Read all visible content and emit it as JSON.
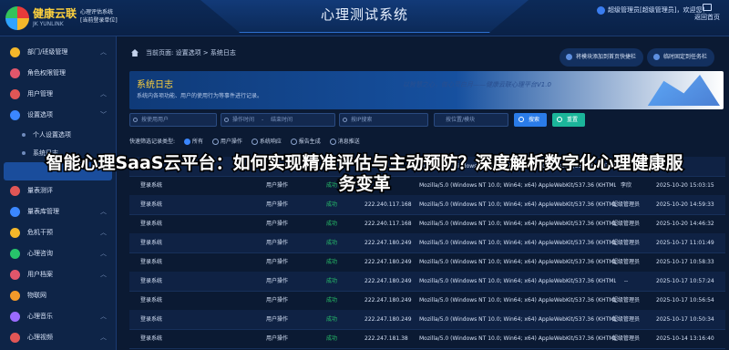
{
  "header": {
    "logo_name": "健康云联",
    "logo_en": "JK YUNLINK",
    "logo_sub1": "心理评估系统",
    "logo_sub2": "[当前登录单位]",
    "system_title": "心理测试系统",
    "user_text": "超级管理员[超级管理员]，欢迎您！",
    "back_home": "返回首页"
  },
  "sidebar": {
    "items": [
      {
        "label": "部门/班级管理",
        "icon": "department-icon",
        "color": "#f3b72a"
      },
      {
        "label": "角色权限管理",
        "icon": "role-icon",
        "color": "#e0566b"
      },
      {
        "label": "用户管理",
        "icon": "user-icon",
        "color": "#e05656"
      },
      {
        "label": "设置选项",
        "icon": "settings-icon",
        "color": "#3b87ff"
      }
    ],
    "subitems": [
      {
        "label": "个人设置选项"
      },
      {
        "label": "系统日志"
      }
    ],
    "items2": [
      {
        "label": "量表测评",
        "icon": "scale-icon",
        "color": "#e05656"
      },
      {
        "label": "量表库管理",
        "icon": "library-icon",
        "color": "#3b87ff"
      },
      {
        "label": "危机干预",
        "icon": "crisis-icon",
        "color": "#f3b72a"
      },
      {
        "label": "心理咨询",
        "icon": "consult-icon",
        "color": "#27c46b"
      },
      {
        "label": "用户档案",
        "icon": "archive-icon",
        "color": "#e0566b"
      },
      {
        "label": "物联网",
        "icon": "iot-icon",
        "color": "#f39a2a"
      },
      {
        "label": "心理音乐",
        "icon": "music-icon",
        "color": "#9a6bff"
      },
      {
        "label": "心理视频",
        "icon": "video-icon",
        "color": "#e05656"
      }
    ]
  },
  "main": {
    "breadcrumb": "当前页面: 设置选项 > 系统日志",
    "pin_button": "将模块添加到首页快捷栏",
    "fix_button": "临时固定到任务栏",
    "banner_title": "系统日志",
    "banner_desc": "系统内各项功能、用户的使用行为等事件进行记录。",
    "banner_slogan": "以智慧之心，做心灵白月——健康云联心理平台V1.0",
    "filters": {
      "user_placeholder": "按使用用户",
      "start_placeholder": "操作时间",
      "end_placeholder": "结束时间",
      "ip_placeholder": "按IP搜索",
      "module_placeholder": "按位置/模块",
      "search_label": "搜索",
      "reset_label": "重置"
    },
    "type_filter": {
      "label": "快速筛选记录类型:",
      "options": [
        "所有",
        "用户操作",
        "系统响应",
        "报告生成",
        "消息推送"
      ]
    },
    "table": {
      "rows": [
        {
          "op": "登录系统",
          "type": "用户操作",
          "status": "成功",
          "ip": "",
          "ua": "Mozilla/5.0 (Windows NT 10.0; Win64; x64) AppleWebKit/537.36 (KHTML, like Gec...",
          "user": "",
          "time": ""
        },
        {
          "op": "登录系统",
          "type": "用户操作",
          "status": "成功",
          "ip": "",
          "ua": "Mozilla/5.0 (Windows NT 10.0; Win64; x64) AppleWebKit/537.36 (KHTML, like Gec...",
          "user": "李欣",
          "time": "2025-10-20 15:03:15"
        },
        {
          "op": "登录系统",
          "type": "用户操作",
          "status": "成功",
          "ip": "222.240.117.168",
          "ua": "Mozilla/5.0 (Windows NT 10.0; Win64; x64) AppleWebKit/537.36 (KHTML, like Gec...",
          "user": "超级管理员",
          "time": "2025-10-20 14:59:33"
        },
        {
          "op": "登录系统",
          "type": "用户操作",
          "status": "成功",
          "ip": "222.240.117.168",
          "ua": "Mozilla/5.0 (Windows NT 10.0; Win64; x64) AppleWebKit/537.36 (KHTML, like Gec...",
          "user": "超级管理员",
          "time": "2025-10-20 14:46:32"
        },
        {
          "op": "登录系统",
          "type": "用户操作",
          "status": "成功",
          "ip": "222.247.180.249",
          "ua": "Mozilla/5.0 (Windows NT 10.0; Win64; x64) AppleWebKit/537.36 (KHTML, like Gec...",
          "user": "超级管理员",
          "time": "2025-10-17 11:01:49"
        },
        {
          "op": "登录系统",
          "type": "用户操作",
          "status": "成功",
          "ip": "222.247.180.249",
          "ua": "Mozilla/5.0 (Windows NT 10.0; Win64; x64) AppleWebKit/537.36 (KHTML, like Gec...",
          "user": "超级管理员",
          "time": "2025-10-17 10:58:33"
        },
        {
          "op": "登录系统",
          "type": "用户操作",
          "status": "成功",
          "ip": "222.247.180.249",
          "ua": "Mozilla/5.0 (Windows NT 10.0; Win64; x64) AppleWebKit/537.36 (KHTML, like Gec...",
          "user": "--",
          "time": "2025-10-17 10:57:24"
        },
        {
          "op": "登录系统",
          "type": "用户操作",
          "status": "成功",
          "ip": "222.247.180.249",
          "ua": "Mozilla/5.0 (Windows NT 10.0; Win64; x64) AppleWebKit/537.36 (KHTML, like Gec...",
          "user": "超级管理员",
          "time": "2025-10-17 10:56:54"
        },
        {
          "op": "登录系统",
          "type": "用户操作",
          "status": "成功",
          "ip": "222.247.180.249",
          "ua": "Mozilla/5.0 (Windows NT 10.0; Win64; x64) AppleWebKit/537.36 (KHTML, like Gec...",
          "user": "超级管理员",
          "time": "2025-10-17 10:50:34"
        },
        {
          "op": "登录系统",
          "type": "用户操作",
          "status": "成功",
          "ip": "222.247.181.38",
          "ua": "Mozilla/5.0 (Windows NT 10.0; Win64; x64) AppleWebKit/537.36 (KHTML, like Gec...",
          "user": "超级管理员",
          "time": "2025-10-14 13:16:40"
        }
      ]
    }
  },
  "overlay": {
    "line1": "智能心理SaaS云平台：如何实现精准评估与主动预防？深度解析数字化心理健康服",
    "line2": "务变革"
  }
}
